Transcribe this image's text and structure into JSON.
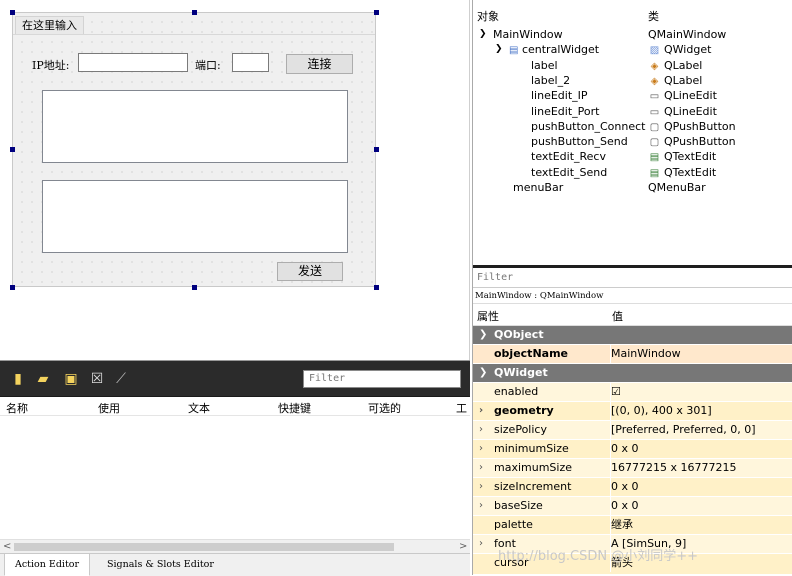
{
  "form": {
    "menu_placeholder": "在这里输入",
    "ip_label": "IP地址:",
    "port_label": "端口:",
    "connect_button": "连接",
    "send_button": "发送"
  },
  "action_editor": {
    "filter_placeholder": "Filter",
    "columns": [
      "名称",
      "使用",
      "文本",
      "快捷键",
      "可选的",
      "工"
    ],
    "tabs": [
      "Action Editor",
      "Signals & Slots Editor"
    ]
  },
  "object_inspector": {
    "header_object": "对象",
    "header_class": "类",
    "rows": [
      {
        "name": "MainWindow",
        "class": "QMainWindow",
        "icon": ""
      },
      {
        "name": "centralWidget",
        "class": "QWidget",
        "icon": "widget-icon"
      },
      {
        "name": "label",
        "class": "QLabel",
        "icon": "label-icon"
      },
      {
        "name": "label_2",
        "class": "QLabel",
        "icon": "label-icon"
      },
      {
        "name": "lineEdit_IP",
        "class": "QLineEdit",
        "icon": "lineedit-icon"
      },
      {
        "name": "lineEdit_Port",
        "class": "QLineEdit",
        "icon": "lineedit-icon"
      },
      {
        "name": "pushButton_Connect",
        "class": "QPushButton",
        "icon": "pushbutton-icon"
      },
      {
        "name": "pushButton_Send",
        "class": "QPushButton",
        "icon": "pushbutton-icon"
      },
      {
        "name": "textEdit_Recv",
        "class": "QTextEdit",
        "icon": "textedit-icon"
      },
      {
        "name": "textEdit_Send",
        "class": "QTextEdit",
        "icon": "textedit-icon"
      },
      {
        "name": "menuBar",
        "class": "QMenuBar",
        "icon": ""
      }
    ]
  },
  "property_editor": {
    "filter_placeholder": "Filter",
    "title": "MainWindow : QMainWindow",
    "header_property": "属性",
    "header_value": "值",
    "rows": [
      {
        "name": "QObject",
        "value": ""
      },
      {
        "name": "objectName",
        "value": "MainWindow"
      },
      {
        "name": "QWidget",
        "value": ""
      },
      {
        "name": "enabled",
        "value": "☑"
      },
      {
        "name": "geometry",
        "value": "[(0, 0), 400 x 301]"
      },
      {
        "name": "sizePolicy",
        "value": "[Preferred, Preferred, 0, 0]"
      },
      {
        "name": "minimumSize",
        "value": "0 x 0"
      },
      {
        "name": "maximumSize",
        "value": "16777215 x 16777215"
      },
      {
        "name": "sizeIncrement",
        "value": "0 x 0"
      },
      {
        "name": "baseSize",
        "value": "0 x 0"
      },
      {
        "name": "palette",
        "value": "继承"
      },
      {
        "name": "font",
        "value": "A  [SimSun, 9]"
      },
      {
        "name": "cursor",
        "value": "箭头"
      }
    ]
  },
  "watermark": "http://blog.CSDN @小刘同学++"
}
